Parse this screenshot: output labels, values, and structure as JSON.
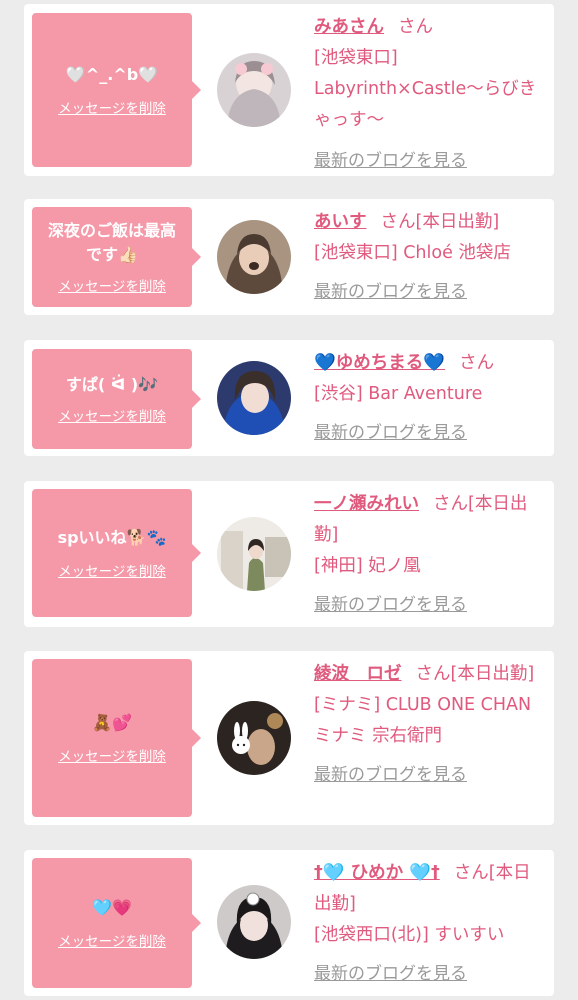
{
  "delete_label": "メッセージを削除",
  "blog_label": "最新のブログを見る",
  "san_label": "さん",
  "cards": [
    {
      "message": "🤍^_.^b🤍",
      "name": "みあさん",
      "suffix": "さん",
      "shop": "[池袋東口] Labyrinth×Castle〜らびきゃっす〜"
    },
    {
      "message": "深夜のご飯は最高です👍🏻",
      "name": "あいす",
      "suffix": "さん[本日出勤]",
      "shop": "[池袋東口] Chloé 池袋店"
    },
    {
      "message": "すぱ( ᐛ )🎶",
      "name": "💙ゆめちまる💙",
      "suffix": "さん",
      "shop": "[渋谷] Bar Aventure"
    },
    {
      "message": "spいいね🐕🐾",
      "name": "一ノ瀬みれい",
      "suffix": "さん[本日出勤]",
      "shop": "[神田] 妃ノ凰"
    },
    {
      "message": "🧸💕",
      "name": "綾波　ロゼ",
      "suffix": "さん[本日出勤]",
      "shop": "[ミナミ] CLUB ONE CHAN ミナミ 宗右衛門"
    },
    {
      "message": "🩵💗",
      "name": "†🩵 ひめか 🩵†",
      "suffix": "さん[本日出勤]",
      "shop": "[池袋西口(北)] すいすい"
    }
  ],
  "colors": {
    "background": "#ececec",
    "bubble": "#f598a8",
    "accent_text": "#e05a7e",
    "link_gray": "#9a9a9a"
  }
}
